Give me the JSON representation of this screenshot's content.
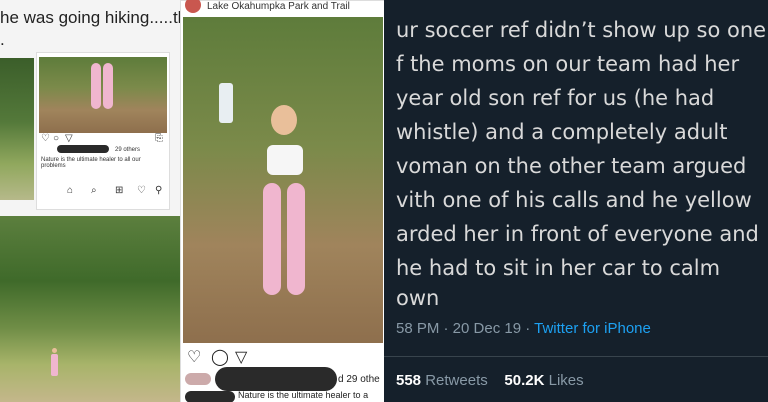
{
  "left": {
    "caption_line1": "he was going hiking.....this",
    "caption_line2": ".",
    "location": "Lake Okahumpka Park and Trail",
    "likes": "d 29 othe",
    "post_caption": "Nature is the ultimate healer to a",
    "mini_likes": "29 others",
    "mini_caption": "Nature is the ultimate healer to all our problems"
  },
  "tweet": {
    "lines": [
      "ur soccer ref didn’t show up so one",
      "f the moms on our team had her",
      " year old son ref for us (he had",
      " whistle) and a completely adult",
      "voman on the other team argued",
      "vith one of his calls and he yellow",
      "arded her in front of everyone and",
      "he had to sit in her car to calm",
      "own"
    ],
    "time": "58 PM · 20 Dec 19 ·",
    "source": "Twitter for iPhone",
    "retweets_num": "558",
    "retweets_label": "Retweets",
    "likes_num": "50.2K",
    "likes_label": "Likes"
  },
  "colors": {
    "tweet_bg": "#15202b",
    "link": "#1da1f2",
    "pink": "#f0b6cf"
  }
}
